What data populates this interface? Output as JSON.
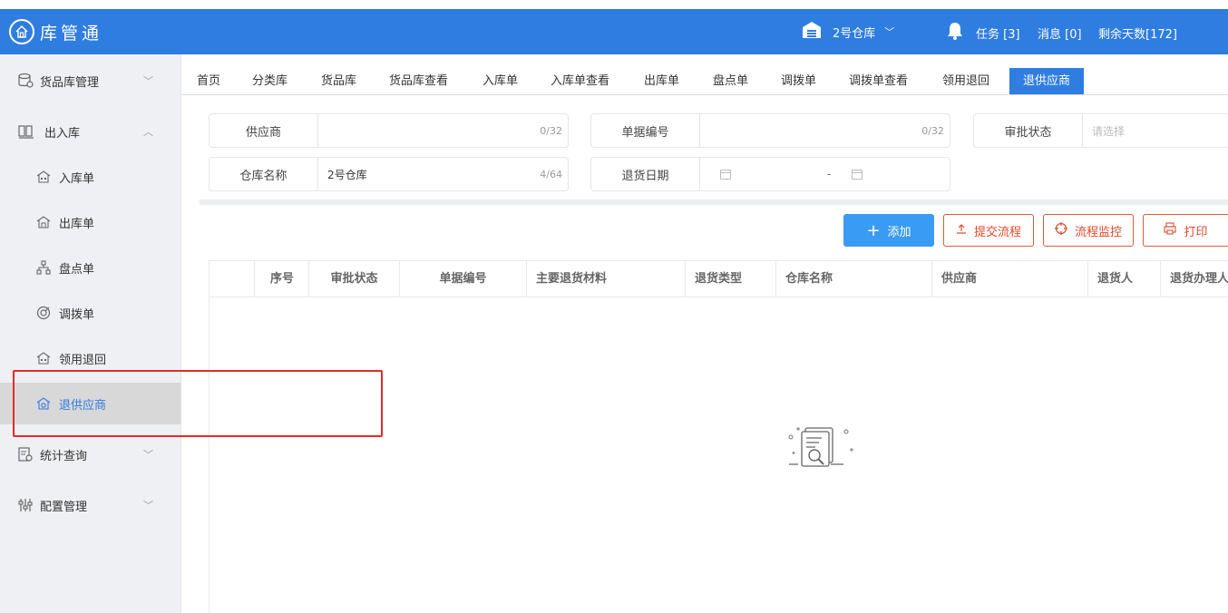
{
  "header": {
    "app_title": "库管通",
    "warehouse": "2号仓库",
    "tasks": "任务 [3]",
    "messages": "消息 [0]",
    "days_left": "剩余天数[172]",
    "brand_color": "#2f7de1"
  },
  "sidebar": {
    "groups": [
      {
        "label": "货品库管理",
        "icon": "goods-db-icon",
        "expanded": false
      },
      {
        "label": "出入库",
        "icon": "in-out-icon",
        "expanded": true
      },
      {
        "label": "统计查询",
        "icon": "stats-icon",
        "expanded": false
      },
      {
        "label": "配置管理",
        "icon": "config-icon",
        "expanded": false
      }
    ],
    "sub_items": [
      {
        "label": "入库单",
        "icon": "warehouse-in-icon"
      },
      {
        "label": "出库单",
        "icon": "warehouse-out-icon"
      },
      {
        "label": "盘点单",
        "icon": "inventory-icon"
      },
      {
        "label": "调拨单",
        "icon": "transfer-icon"
      },
      {
        "label": "领用退回",
        "icon": "return-icon"
      },
      {
        "label": "退供应商",
        "icon": "supplier-return-icon",
        "active": true
      }
    ]
  },
  "tabs": [
    {
      "label": "首页"
    },
    {
      "label": "分类库"
    },
    {
      "label": "货品库"
    },
    {
      "label": "货品库查看"
    },
    {
      "label": "入库单"
    },
    {
      "label": "入库单查看"
    },
    {
      "label": "出库单"
    },
    {
      "label": "盘点单"
    },
    {
      "label": "调拨单"
    },
    {
      "label": "调拨单查看"
    },
    {
      "label": "领用退回"
    },
    {
      "label": "退供应商",
      "active": true
    }
  ],
  "filters": {
    "supplier": {
      "label": "供应商",
      "value": "",
      "count": "0/32"
    },
    "doc_no": {
      "label": "单据编号",
      "value": "",
      "count": "0/32"
    },
    "approval": {
      "label": "审批状态",
      "placeholder": "请选择"
    },
    "warehouse": {
      "label": "仓库名称",
      "value": "2号仓库",
      "count": "4/64"
    },
    "return_date": {
      "label": "退货日期",
      "separator": "-"
    }
  },
  "actions": {
    "add": "添加",
    "submit_flow": "提交流程",
    "monitor_flow": "流程监控",
    "print": "打印"
  },
  "table": {
    "columns": [
      "序号",
      "审批状态",
      "单据编号",
      "主要退货材料",
      "退货类型",
      "仓库名称",
      "供应商",
      "退货人",
      "退货办理人"
    ],
    "rows": []
  }
}
